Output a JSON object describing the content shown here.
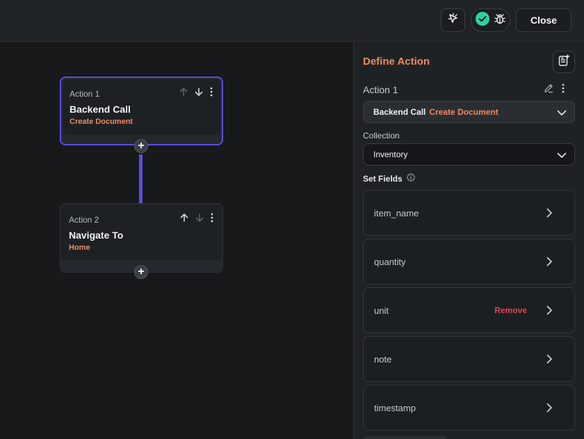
{
  "topbar": {
    "close_label": "Close",
    "status_color": "#2fd0a0"
  },
  "canvas": {
    "actions": [
      {
        "label": "Action 1",
        "title": "Backend Call",
        "subtitle": "Create Document",
        "selected": true
      },
      {
        "label": "Action 2",
        "title": "Navigate To",
        "subtitle": "Home",
        "selected": false
      }
    ]
  },
  "panel": {
    "title": "Define Action",
    "action_label": "Action 1",
    "action_type": {
      "name": "Backend Call",
      "detail": "Create Document"
    },
    "collection_label": "Collection",
    "collection_value": "Inventory",
    "set_fields_label": "Set Fields",
    "fields": [
      {
        "name": "item_name"
      },
      {
        "name": "quantity"
      },
      {
        "name": "unit",
        "action": "Remove"
      },
      {
        "name": "note"
      },
      {
        "name": "timestamp"
      }
    ]
  },
  "colors": {
    "accent": "#ef8a5e",
    "selection": "#5b4de4",
    "danger": "#e0474c"
  }
}
